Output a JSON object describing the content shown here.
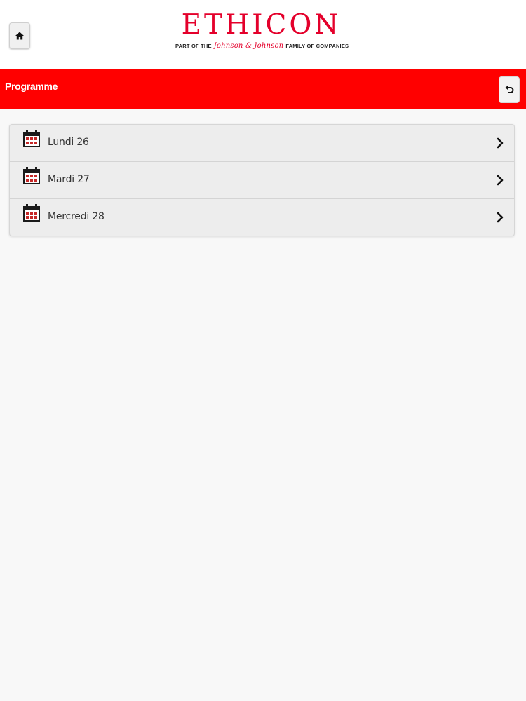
{
  "brand": {
    "name": "ETHICON",
    "tagline_prefix": "PART OF THE",
    "tagline_script": "Johnson & Johnson",
    "tagline_suffix": "FAMILY OF COMPANIES",
    "color": "#e4002b"
  },
  "toolbar": {
    "home_icon": "home-icon",
    "back_icon": "back-arrow-icon"
  },
  "header": {
    "title": "Programme",
    "background": "#ff0000"
  },
  "list": {
    "items": [
      {
        "label": "Lundi 26",
        "icon": "calendar-icon"
      },
      {
        "label": "Mardi 27",
        "icon": "calendar-icon"
      },
      {
        "label": "Mercredi 28",
        "icon": "calendar-icon"
      }
    ]
  }
}
